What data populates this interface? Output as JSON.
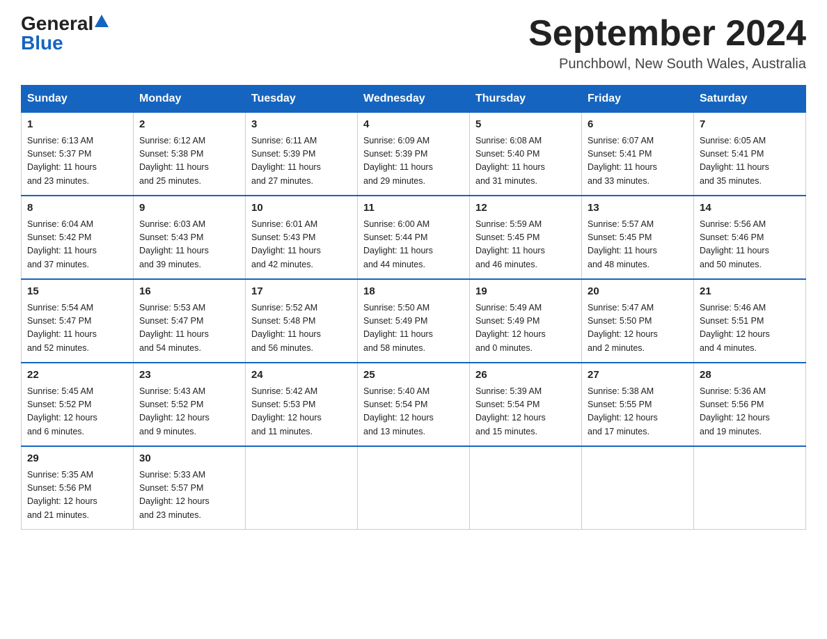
{
  "logo": {
    "general": "General",
    "blue": "Blue"
  },
  "title": {
    "month_year": "September 2024",
    "location": "Punchbowl, New South Wales, Australia"
  },
  "headers": [
    "Sunday",
    "Monday",
    "Tuesday",
    "Wednesday",
    "Thursday",
    "Friday",
    "Saturday"
  ],
  "weeks": [
    [
      {
        "day": "1",
        "sunrise": "6:13 AM",
        "sunset": "5:37 PM",
        "daylight": "11 hours and 23 minutes."
      },
      {
        "day": "2",
        "sunrise": "6:12 AM",
        "sunset": "5:38 PM",
        "daylight": "11 hours and 25 minutes."
      },
      {
        "day": "3",
        "sunrise": "6:11 AM",
        "sunset": "5:39 PM",
        "daylight": "11 hours and 27 minutes."
      },
      {
        "day": "4",
        "sunrise": "6:09 AM",
        "sunset": "5:39 PM",
        "daylight": "11 hours and 29 minutes."
      },
      {
        "day": "5",
        "sunrise": "6:08 AM",
        "sunset": "5:40 PM",
        "daylight": "11 hours and 31 minutes."
      },
      {
        "day": "6",
        "sunrise": "6:07 AM",
        "sunset": "5:41 PM",
        "daylight": "11 hours and 33 minutes."
      },
      {
        "day": "7",
        "sunrise": "6:05 AM",
        "sunset": "5:41 PM",
        "daylight": "11 hours and 35 minutes."
      }
    ],
    [
      {
        "day": "8",
        "sunrise": "6:04 AM",
        "sunset": "5:42 PM",
        "daylight": "11 hours and 37 minutes."
      },
      {
        "day": "9",
        "sunrise": "6:03 AM",
        "sunset": "5:43 PM",
        "daylight": "11 hours and 39 minutes."
      },
      {
        "day": "10",
        "sunrise": "6:01 AM",
        "sunset": "5:43 PM",
        "daylight": "11 hours and 42 minutes."
      },
      {
        "day": "11",
        "sunrise": "6:00 AM",
        "sunset": "5:44 PM",
        "daylight": "11 hours and 44 minutes."
      },
      {
        "day": "12",
        "sunrise": "5:59 AM",
        "sunset": "5:45 PM",
        "daylight": "11 hours and 46 minutes."
      },
      {
        "day": "13",
        "sunrise": "5:57 AM",
        "sunset": "5:45 PM",
        "daylight": "11 hours and 48 minutes."
      },
      {
        "day": "14",
        "sunrise": "5:56 AM",
        "sunset": "5:46 PM",
        "daylight": "11 hours and 50 minutes."
      }
    ],
    [
      {
        "day": "15",
        "sunrise": "5:54 AM",
        "sunset": "5:47 PM",
        "daylight": "11 hours and 52 minutes."
      },
      {
        "day": "16",
        "sunrise": "5:53 AM",
        "sunset": "5:47 PM",
        "daylight": "11 hours and 54 minutes."
      },
      {
        "day": "17",
        "sunrise": "5:52 AM",
        "sunset": "5:48 PM",
        "daylight": "11 hours and 56 minutes."
      },
      {
        "day": "18",
        "sunrise": "5:50 AM",
        "sunset": "5:49 PM",
        "daylight": "11 hours and 58 minutes."
      },
      {
        "day": "19",
        "sunrise": "5:49 AM",
        "sunset": "5:49 PM",
        "daylight": "12 hours and 0 minutes."
      },
      {
        "day": "20",
        "sunrise": "5:47 AM",
        "sunset": "5:50 PM",
        "daylight": "12 hours and 2 minutes."
      },
      {
        "day": "21",
        "sunrise": "5:46 AM",
        "sunset": "5:51 PM",
        "daylight": "12 hours and 4 minutes."
      }
    ],
    [
      {
        "day": "22",
        "sunrise": "5:45 AM",
        "sunset": "5:52 PM",
        "daylight": "12 hours and 6 minutes."
      },
      {
        "day": "23",
        "sunrise": "5:43 AM",
        "sunset": "5:52 PM",
        "daylight": "12 hours and 9 minutes."
      },
      {
        "day": "24",
        "sunrise": "5:42 AM",
        "sunset": "5:53 PM",
        "daylight": "12 hours and 11 minutes."
      },
      {
        "day": "25",
        "sunrise": "5:40 AM",
        "sunset": "5:54 PM",
        "daylight": "12 hours and 13 minutes."
      },
      {
        "day": "26",
        "sunrise": "5:39 AM",
        "sunset": "5:54 PM",
        "daylight": "12 hours and 15 minutes."
      },
      {
        "day": "27",
        "sunrise": "5:38 AM",
        "sunset": "5:55 PM",
        "daylight": "12 hours and 17 minutes."
      },
      {
        "day": "28",
        "sunrise": "5:36 AM",
        "sunset": "5:56 PM",
        "daylight": "12 hours and 19 minutes."
      }
    ],
    [
      {
        "day": "29",
        "sunrise": "5:35 AM",
        "sunset": "5:56 PM",
        "daylight": "12 hours and 21 minutes."
      },
      {
        "day": "30",
        "sunrise": "5:33 AM",
        "sunset": "5:57 PM",
        "daylight": "12 hours and 23 minutes."
      },
      null,
      null,
      null,
      null,
      null
    ]
  ],
  "labels": {
    "sunrise": "Sunrise:",
    "sunset": "Sunset:",
    "daylight": "Daylight:"
  }
}
